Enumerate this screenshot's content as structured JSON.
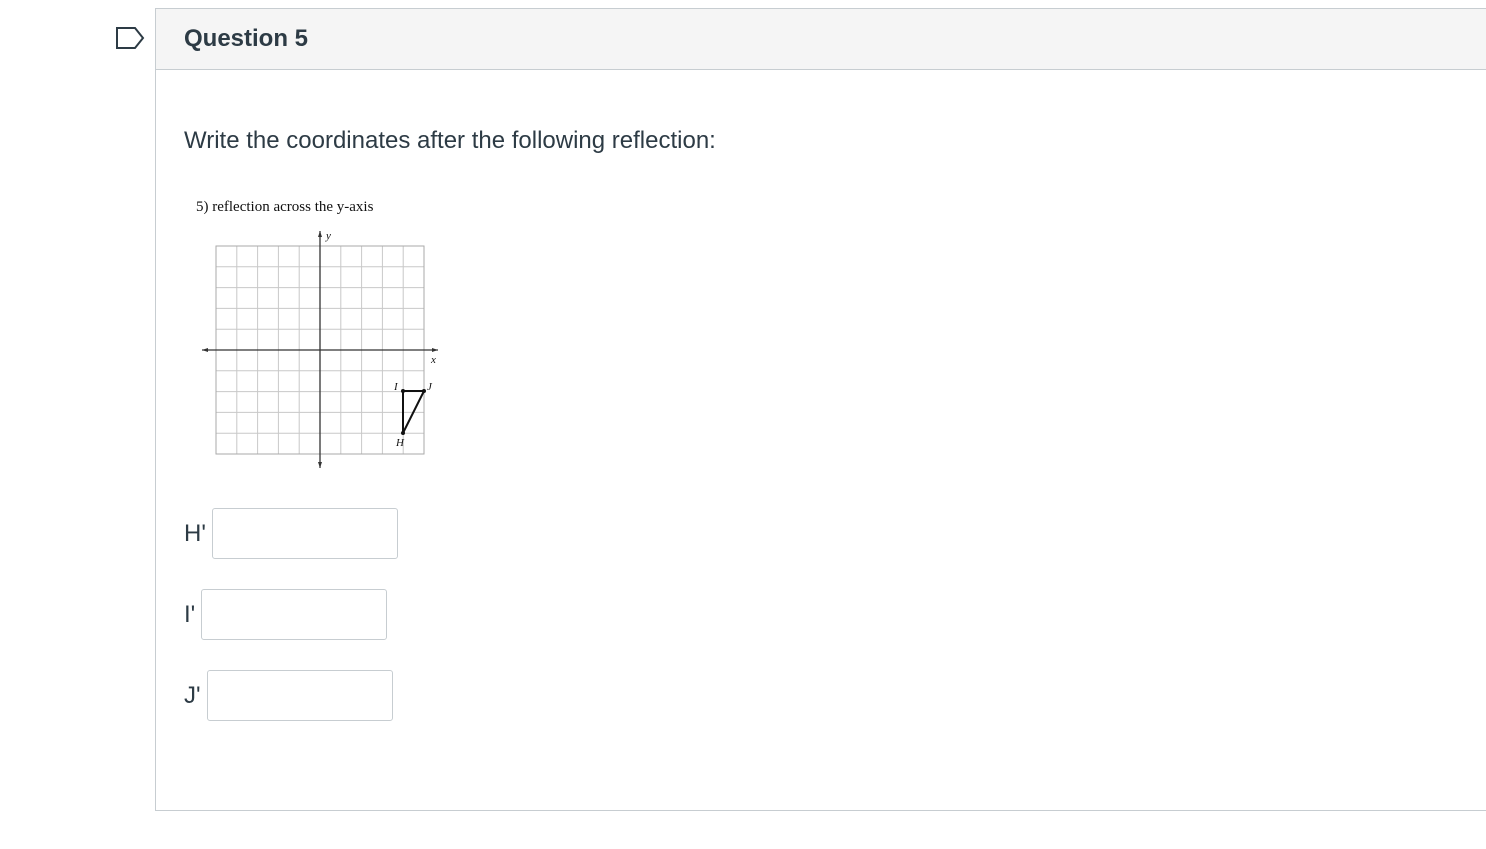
{
  "question": {
    "title": "Question 5",
    "prompt": "Write the coordinates after the following reflection:"
  },
  "figure": {
    "caption": "5) reflection across the y-axis",
    "axis_x_label": "x",
    "axis_y_label": "y",
    "point_labels": {
      "H": "H",
      "I": "I",
      "J": "J"
    }
  },
  "answers": [
    {
      "label": "H'",
      "value": "",
      "placeholder": ""
    },
    {
      "label": "I'",
      "value": "",
      "placeholder": ""
    },
    {
      "label": "J'",
      "value": "",
      "placeholder": ""
    }
  ],
  "colors": {
    "border": "#c7cdd1",
    "header_bg": "#f5f5f5",
    "text": "#2d3b45",
    "flag": "#2d3b45"
  }
}
